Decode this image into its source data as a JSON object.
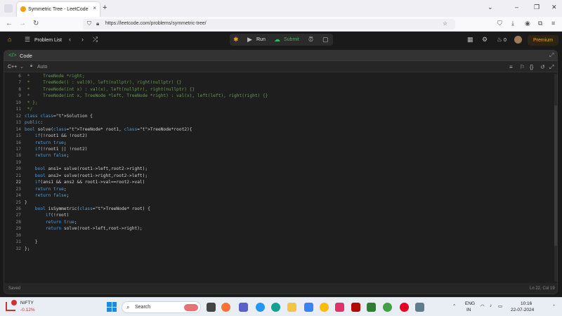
{
  "browser": {
    "tab_title": "Symmetric Tree - LeetCode",
    "tab_close": "×",
    "new_tab": "+",
    "url": "https://leetcode.com/problems/symmetric-tree/",
    "window_controls": [
      "–",
      "❐",
      "✕"
    ]
  },
  "leetcode_header": {
    "problem_list": "Problem List",
    "run_label": "Run",
    "submit_label": "Submit",
    "coins": "0",
    "premium_label": "Premium"
  },
  "panel": {
    "title": "Code",
    "language": "C++",
    "auto_label": "Auto",
    "status": "Saved",
    "cursor": "Ln 22, Col 19"
  },
  "code_lines": [
    {
      "n": "6",
      "text": " *     TreeNode *right;"
    },
    {
      "n": "7",
      "text": " *     TreeNode() : val(0), left(nullptr), right(nullptr) {}"
    },
    {
      "n": "8",
      "text": " *     TreeNode(int x) : val(x), left(nullptr), right(nullptr) {}"
    },
    {
      "n": "9",
      "text": " *     TreeNode(int x, TreeNode *left, TreeNode *right) : val(x), left(left), right(right) {}"
    },
    {
      "n": "10",
      "text": " * };"
    },
    {
      "n": "11",
      "text": " */"
    },
    {
      "n": "12",
      "text": "class Solution {"
    },
    {
      "n": "13",
      "text": "public:"
    },
    {
      "n": "14",
      "text": "bool solve(TreeNode* root1, TreeNode*root2){"
    },
    {
      "n": "15",
      "text": "    if(!root1 && !root2)"
    },
    {
      "n": "16",
      "text": "    return true;"
    },
    {
      "n": "17",
      "text": "    if(!root1 || !root2)"
    },
    {
      "n": "18",
      "text": "    return false;"
    },
    {
      "n": "19",
      "text": ""
    },
    {
      "n": "20",
      "text": "    bool ans1= solve(root1->left,root2->right);"
    },
    {
      "n": "21",
      "text": "    bool ans2= solve(root1->right,root2->left);"
    },
    {
      "n": "22",
      "text": "    if(ans1 && ans2 && root1->val==root2->val)"
    },
    {
      "n": "23",
      "text": "    return true;"
    },
    {
      "n": "24",
      "text": "    return false;"
    },
    {
      "n": "25",
      "text": "}"
    },
    {
      "n": "26",
      "text": "    bool isSymmetric(TreeNode* root) {"
    },
    {
      "n": "27",
      "text": "        if(!root)"
    },
    {
      "n": "28",
      "text": "        return true;"
    },
    {
      "n": "29",
      "text": "        return solve(root->left,root->right);"
    },
    {
      "n": "30",
      "text": ""
    },
    {
      "n": "31",
      "text": "    }"
    },
    {
      "n": "32",
      "text": "};"
    }
  ],
  "taskbar": {
    "stock_name": "NIFTY",
    "stock_change": "-0.12%",
    "search_placeholder": "Search",
    "lang_top": "ENG",
    "lang_bottom": "IN",
    "time": "10:16",
    "date": "22-07-2024"
  },
  "colors": {
    "keyword": "#569cd6",
    "type": "#4ec9b0",
    "comment": "#6a9955",
    "submit": "#2cbb5d",
    "premium": "#f0a318"
  }
}
